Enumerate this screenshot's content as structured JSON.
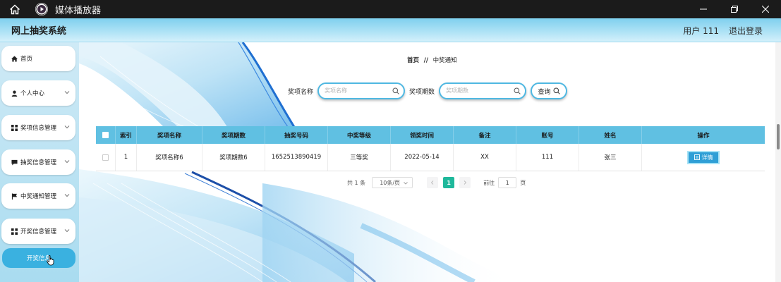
{
  "window": {
    "title": "媒体播放器"
  },
  "header": {
    "app_name": "网上抽奖系统",
    "user_label": "用户 111",
    "logout_label": "退出登录"
  },
  "sidebar": {
    "items": [
      {
        "label": "首页",
        "icon": "home-icon"
      },
      {
        "label": "个人中心",
        "icon": "person-icon"
      },
      {
        "label": "奖项信息管理",
        "icon": "grid-icon"
      },
      {
        "label": "抽奖信息管理",
        "icon": "chat-icon"
      },
      {
        "label": "中奖通知管理",
        "icon": "flag-icon"
      },
      {
        "label": "开奖信息管理",
        "icon": "grid-icon"
      }
    ],
    "active_label": "开奖信息"
  },
  "breadcrumb": {
    "home": "首页",
    "separator": "//",
    "current": "中奖通知"
  },
  "search": {
    "field1_label": "奖项名称",
    "field1_placeholder": "奖项名称",
    "field2_label": "奖项期数",
    "field2_placeholder": "奖项期数",
    "button_label": "查询"
  },
  "table": {
    "headers": [
      "索引",
      "奖项名称",
      "奖项期数",
      "抽奖号码",
      "中奖等级",
      "领奖时间",
      "备注",
      "账号",
      "姓名",
      "操作"
    ],
    "rows": [
      {
        "index": "1",
        "prize_name": "奖项名称6",
        "prize_period": "奖项期数6",
        "lottery_number": "1652513890419",
        "prize_level": "三等奖",
        "claim_time": "2022-05-14",
        "remark": "XX",
        "account": "111",
        "name": "张三",
        "action": "详情"
      }
    ]
  },
  "pagination": {
    "total": "共 1 条",
    "page_size": "10条/页",
    "current_page": "1",
    "goto_prefix": "前往",
    "goto_value": "1",
    "goto_suffix": "页"
  },
  "colors": {
    "accent": "#3ab1e0",
    "table_header": "#60c0e2",
    "page_active": "#1fb89b",
    "detail_button": "#2f9fd6"
  }
}
